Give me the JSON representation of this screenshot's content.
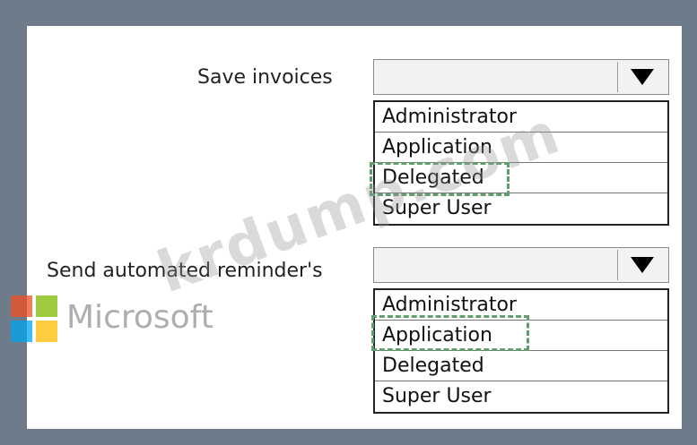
{
  "questions": [
    {
      "label": "Save invoices",
      "options": [
        "Administrator",
        "Application",
        "Delegated",
        "Super User"
      ],
      "selected_index": 2
    },
    {
      "label": "Send automated reminder's",
      "options": [
        "Administrator",
        "Application",
        "Delegated",
        "Super User"
      ],
      "selected_index": 1
    }
  ],
  "watermark": {
    "text": "krdump.com",
    "logo_text": "Microsoft"
  },
  "colors": {
    "frame": "#6d7b8a",
    "selection_box": "#5f9e6e",
    "logo": [
      "#f25022",
      "#7fba00",
      "#00a4ef",
      "#ffb900"
    ]
  }
}
